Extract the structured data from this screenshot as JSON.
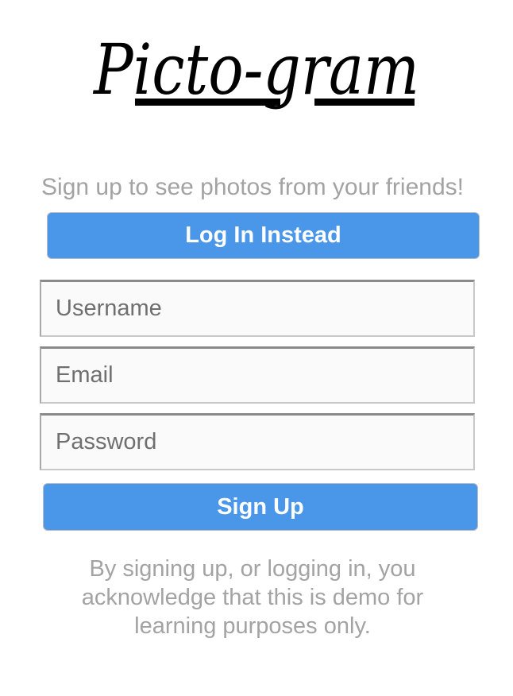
{
  "brand": {
    "logo_text": "Picto-gram"
  },
  "signup": {
    "tagline": "Sign up to see photos from your friends!",
    "login_instead_label": "Log In Instead",
    "username_placeholder": "Username",
    "email_placeholder": "Email",
    "password_placeholder": "Password",
    "submit_label": "Sign Up",
    "disclaimer": "By signing up, or logging in, you acknowledge that this is demo for learning purposes only."
  },
  "colors": {
    "accent": "#4a96e8",
    "muted_text": "#a3a3a3",
    "field_bg": "#fafafa"
  }
}
